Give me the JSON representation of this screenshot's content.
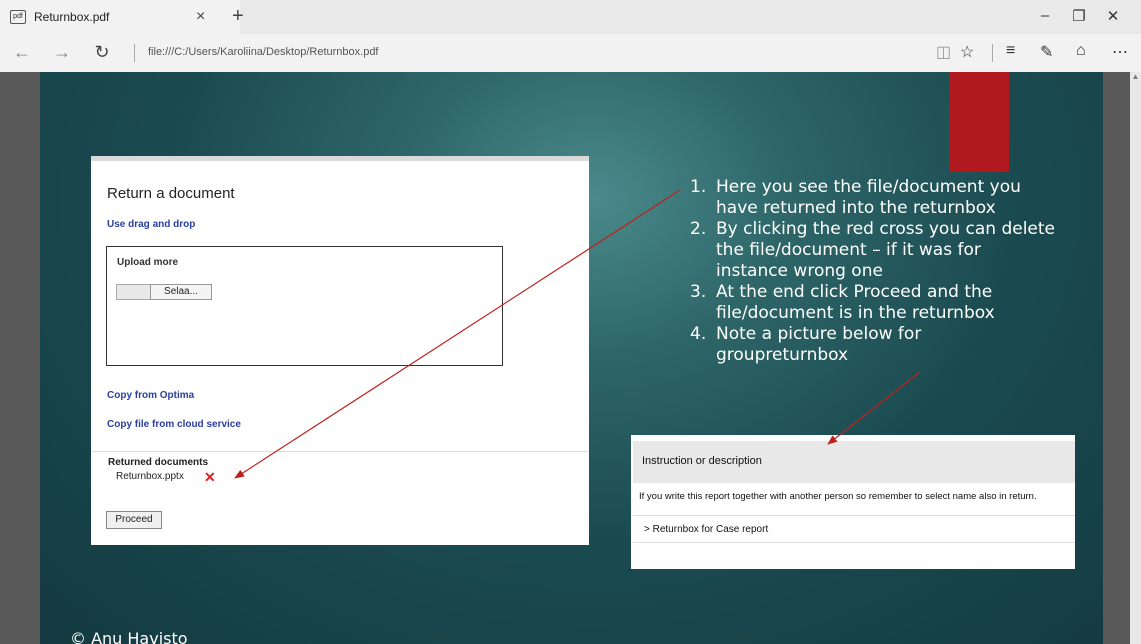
{
  "browser": {
    "tab_title": "Returnbox.pdf",
    "favicon_text": "pdf",
    "close_tab_glyph": "×",
    "new_tab_glyph": "+",
    "url": "file:///C:/Users/Karoliina/Desktop/Returnbox.pdf",
    "icons": [
      "back-icon",
      "forward-icon",
      "refresh-icon",
      "reading-view-icon",
      "favorite-star-icon",
      "hub-icon",
      "web-note-icon",
      "share-icon",
      "more-icon",
      "minimize-icon",
      "restore-icon",
      "close-icon"
    ]
  },
  "slide": {
    "panel1": {
      "title": "Return a document",
      "drag_drop": "Use drag and drop",
      "upload_label": "Upload more",
      "browse_button": "Selaa...",
      "copy_optima": "Copy from Optima",
      "copy_cloud": "Copy file from cloud service",
      "returned_heading": "Returned documents",
      "returned_file": "Returnbox.pptx",
      "delete_glyph": "✕",
      "proceed": "Proceed"
    },
    "instructions": [
      {
        "num": "1.",
        "text": "Here you see the file/document you have returned into the returnbox"
      },
      {
        "num": "2.",
        "text": "By clicking the red cross you can delete the file/document – if it was for instance wrong one"
      },
      {
        "num": "3.",
        "text": "At the end click Proceed and the file/document is in the returnbox"
      },
      {
        "num": "4.",
        "text": "Note  a picture below for groupreturnbox"
      }
    ],
    "panel2": {
      "heading": "Instruction or description",
      "description": "If you write this report together with another person so remember to select name also in return.",
      "link": "> Returnbox for Case report"
    },
    "copyright": "© Anu Havisto"
  },
  "colors": {
    "slide_bg": "#1a4a50",
    "accent_red": "#b0191e",
    "link_blue": "#2a3ea0",
    "arrow_red": "#c0201c"
  }
}
